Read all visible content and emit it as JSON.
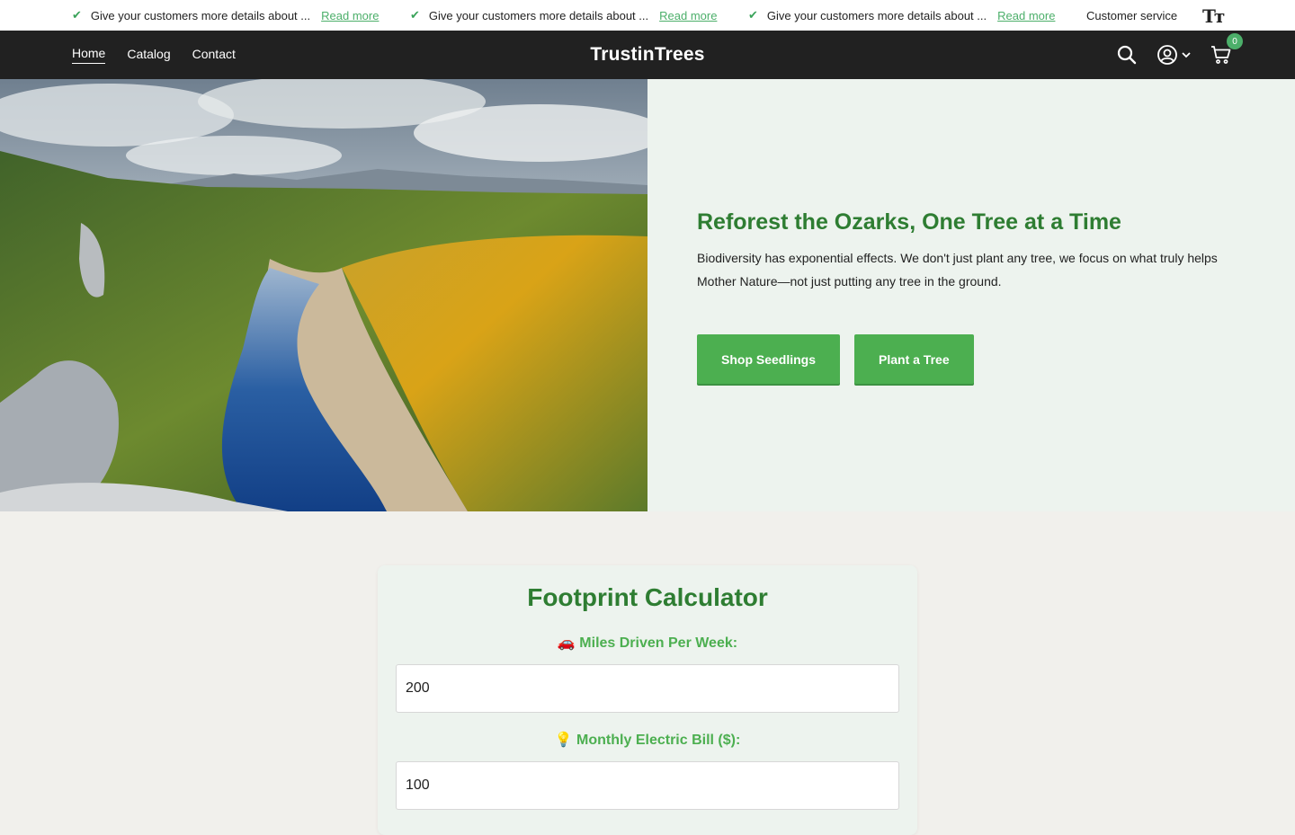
{
  "announcement": {
    "items": [
      {
        "text": "Give your customers more details about ...",
        "link": "Read more"
      },
      {
        "text": "Give your customers more details about ...",
        "link": "Read more"
      },
      {
        "text": "Give your customers more details about ...",
        "link": "Read more"
      }
    ],
    "customer_service": "Customer service",
    "text_size_icon": "Tт"
  },
  "header": {
    "nav": [
      "Home",
      "Catalog",
      "Contact"
    ],
    "logo": "TrustinTrees",
    "cart_count": "0"
  },
  "hero": {
    "title": "Reforest the Ozarks, One Tree at a Time",
    "subtitle": "Biodiversity has exponential effects. We don't just plant any tree, we focus on what truly helps Mother Nature—not just putting any tree in the ground.",
    "buttons": [
      "Shop Seedlings",
      "Plant a Tree"
    ]
  },
  "calculator": {
    "title": "Footprint Calculator",
    "fields": [
      {
        "label": "🚗 Miles Driven Per Week:",
        "value": "200"
      },
      {
        "label": "💡 Monthly Electric Bill ($):",
        "value": "100"
      }
    ]
  },
  "colors": {
    "brand_green": "#2e7d32",
    "button_green": "#4caf50",
    "header_bg": "#212121"
  }
}
